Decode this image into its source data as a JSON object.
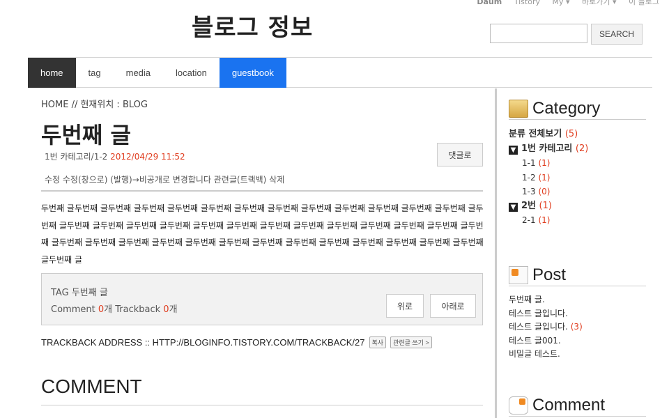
{
  "topbar": {
    "links": [
      "Daum",
      "Tistory",
      "My ▾",
      "바로가기 ▾",
      "이 블로그"
    ]
  },
  "site": {
    "title": "블로그 정보"
  },
  "search": {
    "placeholder": "",
    "button": "SEARCH"
  },
  "nav": {
    "items": [
      "home",
      "tag",
      "media",
      "location",
      "guestbook"
    ],
    "active": "home"
  },
  "post": {
    "breadcrumb": "HOME // 현재위치 : BLOG",
    "title": "두번째 글",
    "category": "1번 카테고리/1-2",
    "date": "2012/04/29 11:52",
    "reply_button": "댓글로",
    "actions": "수정 수정(창으로) (발행)→비공개로 변경합니다 관련글(트랙백) 삭제",
    "body": "두번째 글두번째 글두번째 글두번째 글두번째 글두번째 글두번째 글두번째 글두번째 글두번째 글두번째 글두번째 글두번째 글두번째 글두번째 글두번째 글두번째 글두번째 글두번째 글두번째 글두번째 글두번째 글두번째 글두번째 글두번째 글두번째 글두번째 글두번째 글두번째 글두번째 글두번째 글두번째 글두번째 글두번째 글두번째 글두번째 글두번째 글두번째 글두번째 글두번째 글두번째 글"
  },
  "tagbox": {
    "tag_label": "TAG",
    "tag": "두번째 글",
    "comment_label": "Comment",
    "comment_count": "0",
    "count_unit": "개",
    "trackback_label": "Trackback",
    "trackback_count": "0",
    "up_button": "위로",
    "down_button": "아래로"
  },
  "trackback": {
    "address": "TRACKBACK ADDRESS :: HTTP://BLOGINFO.TISTORY.COM/TRACKBACK/27",
    "copy_button": "복사",
    "write_button": "관련글 쓰기 >"
  },
  "comment_section": {
    "title": "COMMENT"
  },
  "sidebar": {
    "category_title": "Category",
    "categories": [
      {
        "label": "분류 전체보기",
        "count": "(5)"
      },
      {
        "label": "1번 카테고리",
        "count": "(2)"
      },
      {
        "label": "1-1",
        "count": "(1)"
      },
      {
        "label": "1-2",
        "count": "(1)"
      },
      {
        "label": "1-3",
        "count": "(0)"
      },
      {
        "label": "2번",
        "count": "(1)"
      },
      {
        "label": "2-1",
        "count": "(1)"
      }
    ],
    "post_title": "Post",
    "posts": [
      {
        "label": "두번째 글.",
        "count": ""
      },
      {
        "label": "테스트 글입니다.",
        "count": ""
      },
      {
        "label": "테스트 글입니다.",
        "count": "(3)"
      },
      {
        "label": "테스트 글001.",
        "count": ""
      },
      {
        "label": "비밀글 테스트.",
        "count": ""
      }
    ],
    "comment_title": "Comment"
  },
  "colors": {
    "accent_blue": "#1a73f0",
    "nav_active": "#333333",
    "highlight_red": "#e03c1e"
  }
}
